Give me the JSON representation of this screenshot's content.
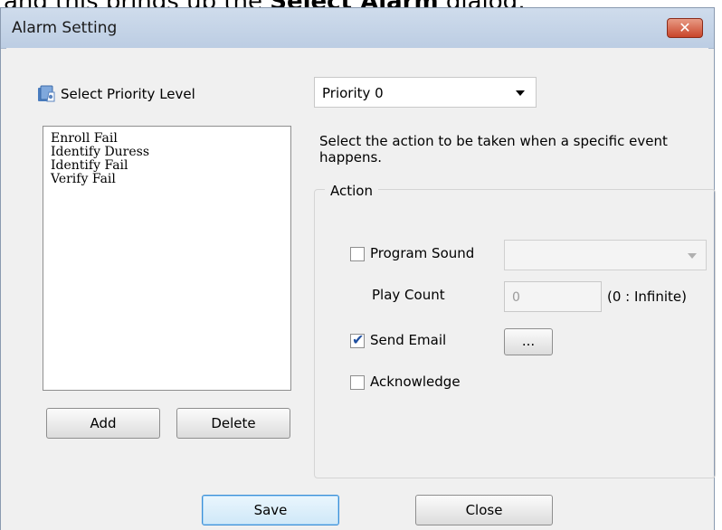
{
  "doc": {
    "text_before": "and this brings up the ",
    "text_bold": "Select Alarm",
    "text_after": " dialog:"
  },
  "window": {
    "title": "Alarm Setting",
    "close_glyph": "✕"
  },
  "priority": {
    "label": "Select Priority Level",
    "selected": "Priority 0",
    "icon": "priority-level-icon"
  },
  "events": {
    "items": [
      "Enroll Fail",
      "Identify Duress",
      "Identify Fail",
      "Verify Fail"
    ]
  },
  "buttons": {
    "add": "Add",
    "delete": "Delete",
    "save": "Save",
    "close": "Close",
    "ellipsis": "..."
  },
  "instructions": "Select the action to be taken when a specific event happens.",
  "action": {
    "group_label": "Action",
    "program_sound": {
      "label": "Program Sound",
      "checked": false,
      "value": ""
    },
    "play_count": {
      "label": "Play Count",
      "value": "0",
      "hint": "(0 : Infinite)"
    },
    "send_email": {
      "label": "Send Email",
      "checked": true
    },
    "acknowledge": {
      "label": "Acknowledge",
      "checked": false
    }
  }
}
